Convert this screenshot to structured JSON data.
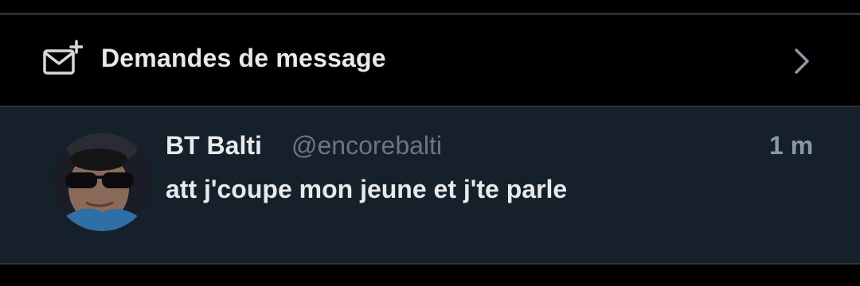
{
  "message_requests": {
    "icon": "envelope-plus-icon",
    "label": "Demandes de message",
    "chevron_icon": "chevron-right-icon"
  },
  "conversation": {
    "display_name": "BT Balti",
    "handle": "@encorebalti",
    "timestamp": "1 m",
    "preview": "att j'coupe mon jeune et j'te parle",
    "avatar_icon": "user-avatar"
  },
  "colors": {
    "background": "#000000",
    "conversation_background": "#15202b",
    "primary_text": "#e7e9ea",
    "secondary_text": "#6e767d",
    "divider": "#2f3336"
  }
}
